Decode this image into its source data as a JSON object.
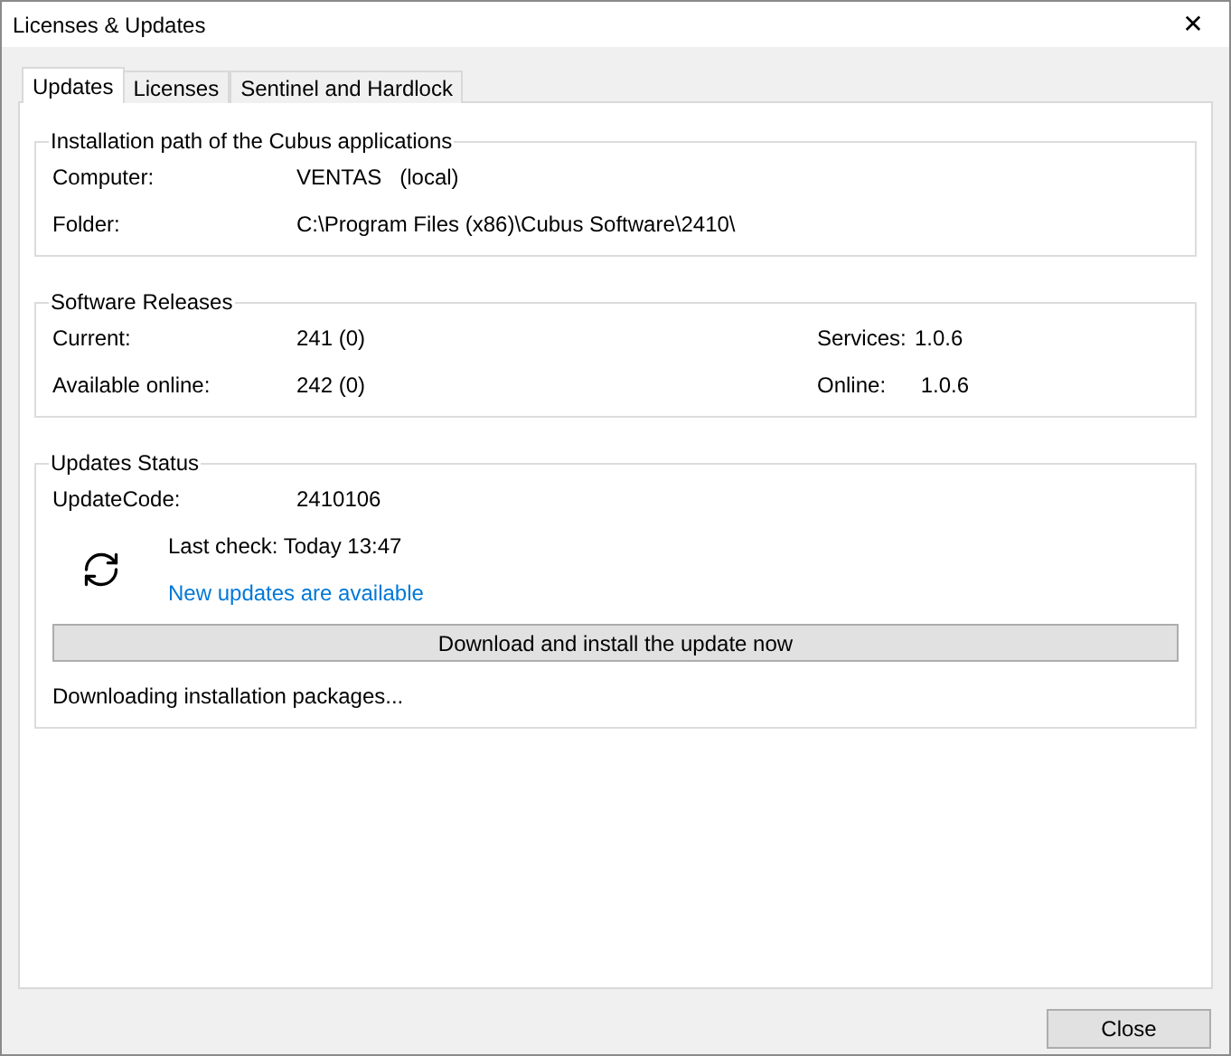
{
  "window": {
    "title": "Licenses & Updates",
    "close_glyph": "✕"
  },
  "tabs": [
    {
      "label": "Updates",
      "selected": true
    },
    {
      "label": "Licenses",
      "selected": false
    },
    {
      "label": "Sentinel and Hardlock",
      "selected": false
    }
  ],
  "installation_path": {
    "title": "Installation path of the Cubus applications",
    "rows": [
      {
        "label": "Computer:",
        "value": "VENTAS   (local)"
      },
      {
        "label": "Folder:",
        "value": "C:\\Program Files (x86)\\Cubus Software\\2410\\"
      }
    ]
  },
  "software_releases": {
    "title": "Software Releases",
    "rows": [
      {
        "label": "Current:",
        "value": "241 (0)",
        "label_2": "Services:",
        "value_2": "1.0.6"
      },
      {
        "label": "Available online:",
        "value": "242 (0)",
        "label_2": "Online:",
        "value_2": " 1.0.6"
      }
    ]
  },
  "updates_status": {
    "title": "Updates Status",
    "update_code_label": "UpdateCode:",
    "update_code": "2410106",
    "last_check": "Last check: Today 13:47",
    "link": "New updates are available",
    "download_button": "Download and install the update now",
    "status_text": "Downloading installation packages..."
  },
  "buttons": [
    "Close"
  ]
}
